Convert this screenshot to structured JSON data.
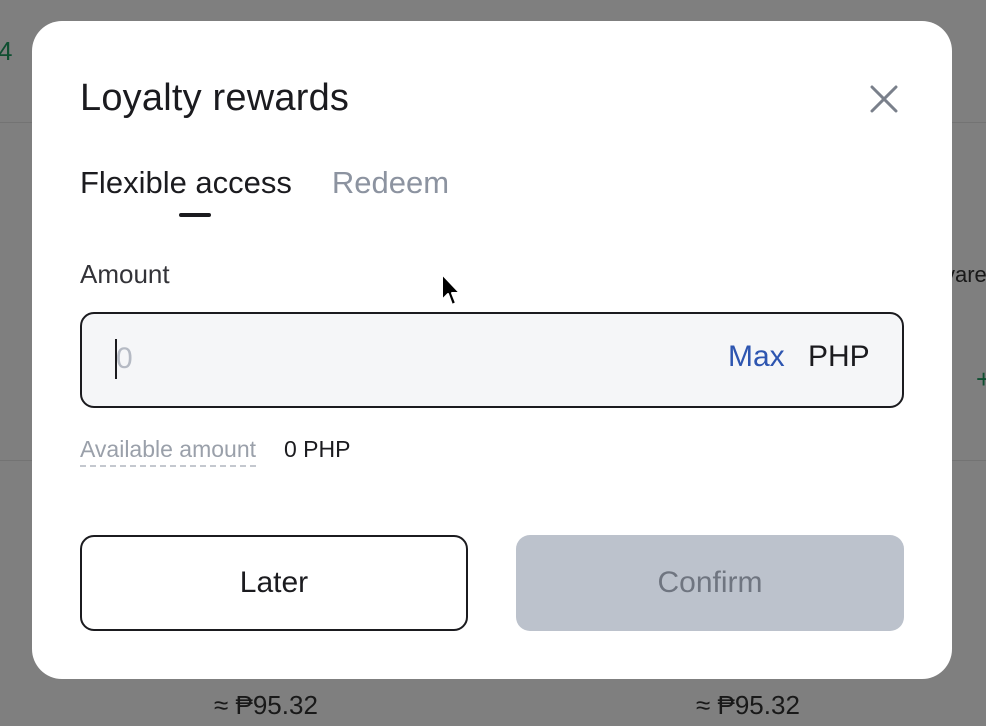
{
  "background": {
    "top_left_fragment": "4",
    "right_fragment": "vare",
    "plus_fragment": "+",
    "price_left": "≈ ₱95.32",
    "price_right": "≈ ₱95.32"
  },
  "modal": {
    "title": "Loyalty rewards",
    "close_icon": "close-icon",
    "tabs": [
      {
        "label": "Flexible access",
        "active": true
      },
      {
        "label": "Redeem",
        "active": false
      }
    ],
    "amount": {
      "label": "Amount",
      "placeholder": "0",
      "value": "",
      "max_label": "Max",
      "currency": "PHP"
    },
    "available": {
      "label": "Available amount",
      "value": "0 PHP"
    },
    "buttons": {
      "later": "Later",
      "confirm": "Confirm"
    }
  },
  "colors": {
    "accent_link": "#2d55b0",
    "primary_text": "#1b1b1f",
    "muted_text": "#8c93a0",
    "disabled_button": "#bcc2cc",
    "background_green": "#1e9e63"
  }
}
